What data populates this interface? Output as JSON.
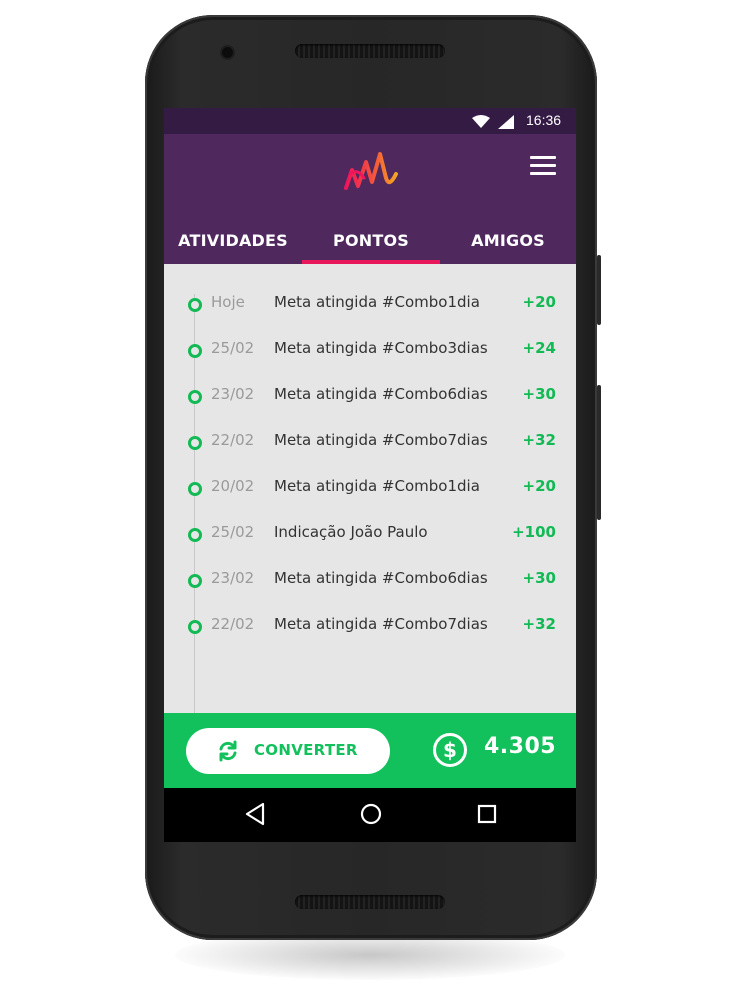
{
  "status_bar": {
    "time": "16:36",
    "icons": [
      "wifi-icon",
      "signal-icon"
    ]
  },
  "app_bar": {
    "logo": "app-logo",
    "menu_icon": "hamburger-menu-icon"
  },
  "tabs": [
    {
      "label": "ATIVIDADES",
      "active": false
    },
    {
      "label": "PONTOS",
      "active": true
    },
    {
      "label": "AMIGOS",
      "active": false
    }
  ],
  "points_history": [
    {
      "date": "Hoje",
      "description": "Meta atingida #Combo1dia",
      "points": "+20"
    },
    {
      "date": "25/02",
      "description": "Meta atingida #Combo3dias",
      "points": "+24"
    },
    {
      "date": "23/02",
      "description": "Meta atingida #Combo6dias",
      "points": "+30"
    },
    {
      "date": "22/02",
      "description": "Meta atingida #Combo7dias",
      "points": "+32"
    },
    {
      "date": "20/02",
      "description": "Meta atingida #Combo1dia",
      "points": "+20"
    },
    {
      "date": "25/02",
      "description": "Indicação João Paulo",
      "points": "+100"
    },
    {
      "date": "23/02",
      "description": "Meta atingida #Combo6dias",
      "points": "+30"
    },
    {
      "date": "22/02",
      "description": "Meta atingida #Combo7dias",
      "points": "+32"
    }
  ],
  "footer": {
    "convert_label": "CONVERTER",
    "convert_icon": "refresh-icon",
    "balance_icon": "dollar-coin-icon",
    "balance": "4.305"
  },
  "nav_bar": [
    "back-icon",
    "home-icon",
    "recents-icon"
  ],
  "colors": {
    "status_bar": "#341b44",
    "app_bar": "#4f285e",
    "accent": "#e8165a",
    "green": "#12c15c",
    "content_bg": "#e6e6e6"
  }
}
